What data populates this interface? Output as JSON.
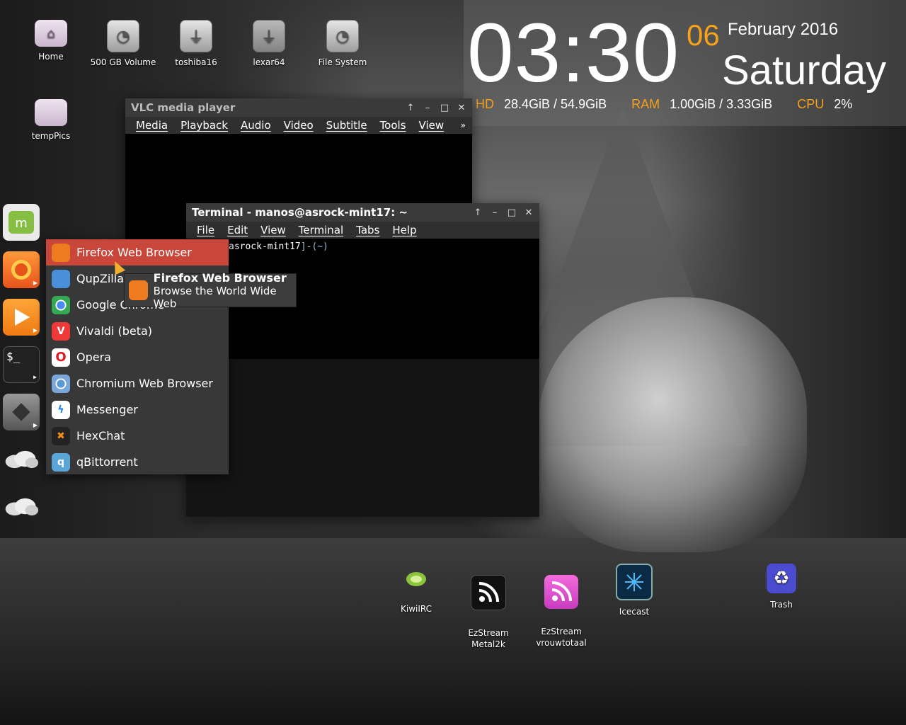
{
  "desktop": {
    "icons": [
      {
        "label": "Home",
        "icon": "home-folder-icon"
      },
      {
        "label": "500 GB Volume",
        "icon": "drive-icon"
      },
      {
        "label": "toshiba16",
        "icon": "usb-icon"
      },
      {
        "label": "lexar64",
        "icon": "usb-icon"
      },
      {
        "label": "File System",
        "icon": "drive-icon"
      },
      {
        "label": "tempPics",
        "icon": "folder-icon"
      }
    ],
    "bottom_icons": [
      {
        "label": "KiwiIRC"
      },
      {
        "label": "EzStream\nMetal2k"
      },
      {
        "label": "EzStream\nvrouwtotaal"
      },
      {
        "label": "Icecast"
      },
      {
        "label": "Trash"
      }
    ]
  },
  "conky": {
    "time": "03:30",
    "day": "06",
    "month_year": "February 2016",
    "weekday": "Saturday",
    "hd_label": "HD",
    "hd_value": "28.4GiB / 54.9GiB",
    "ram_label": "RAM",
    "ram_value": "1.00GiB / 3.33GiB",
    "cpu_label": "CPU",
    "cpu_value": "2%",
    "accent": "#f5a11b"
  },
  "vlc": {
    "title": "VLC media player",
    "menu": [
      "Media",
      "Playback",
      "Audio",
      "Video",
      "Subtitle",
      "Tools",
      "View"
    ],
    "more": "»"
  },
  "terminal": {
    "title": "Terminal - manos@asrock-mint17: ~",
    "menu": [
      "File",
      "Edit",
      "View",
      "Terminal",
      "Tabs",
      "Help"
    ],
    "prompt_host": "asrock-mint17",
    "prompt_rest": "]-(~)"
  },
  "window_buttons": {
    "up": "↑",
    "min": "–",
    "max": "□",
    "close": "✕"
  },
  "menu": {
    "items": [
      {
        "label": "Firefox Web Browser",
        "color": "#ef7b21",
        "glyph": "🦊"
      },
      {
        "label": "QupZilla",
        "color": "#4a90d9",
        "glyph": "◍"
      },
      {
        "label": "Google Chrome",
        "color": "#ffffff",
        "glyph": "◉"
      },
      {
        "label": "Vivaldi (beta)",
        "color": "#ef3939",
        "glyph": "V"
      },
      {
        "label": "Opera",
        "color": "#ffffff",
        "glyph": "O"
      },
      {
        "label": "Chromium Web Browser",
        "color": "#ffffff",
        "glyph": "◉"
      },
      {
        "label": "Messenger",
        "color": "#ffffff",
        "glyph": "ϟ"
      },
      {
        "label": "HexChat",
        "color": "#222222",
        "glyph": "✖"
      },
      {
        "label": "qBittorrent",
        "color": "#5aa6d8",
        "glyph": "q"
      }
    ]
  },
  "tooltip": {
    "title": "Firefox Web Browser",
    "subtitle": "Browse the World Wide Web"
  }
}
